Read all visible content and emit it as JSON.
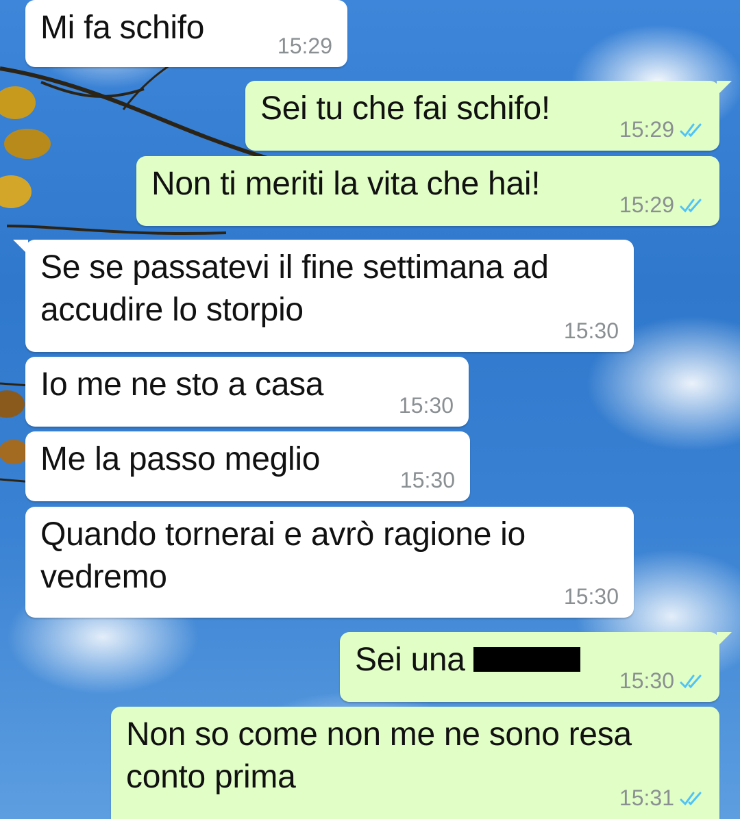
{
  "messages": [
    {
      "text": "Mi fa schifo",
      "time": "15:29",
      "dir": "in"
    },
    {
      "text": "Sei tu che fai schifo!",
      "time": "15:29",
      "dir": "out"
    },
    {
      "text": "Non ti meriti la vita che hai!",
      "time": "15:29",
      "dir": "out"
    },
    {
      "text": "Se se passatevi il fine settimana ad accudire lo storpio",
      "time": "15:30",
      "dir": "in"
    },
    {
      "text": "Io me ne sto a casa",
      "time": "15:30",
      "dir": "in"
    },
    {
      "text": "Me la passo meglio",
      "time": "15:30",
      "dir": "in"
    },
    {
      "text": "Quando tornerai e avrò ragione io vedremo",
      "time": "15:30",
      "dir": "in"
    },
    {
      "text": "Sei una",
      "time": "15:30",
      "dir": "out",
      "redacted": true
    },
    {
      "text": "Non so come non me ne sono resa conto prima",
      "time": "15:31",
      "dir": "out"
    }
  ],
  "colors": {
    "incoming_bubble": "#ffffff",
    "outgoing_bubble": "#e1fec6",
    "read_ticks": "#4fc3f7",
    "timestamp": "#8a8f92"
  },
  "icons": {
    "read_receipt": "double-check-icon"
  }
}
